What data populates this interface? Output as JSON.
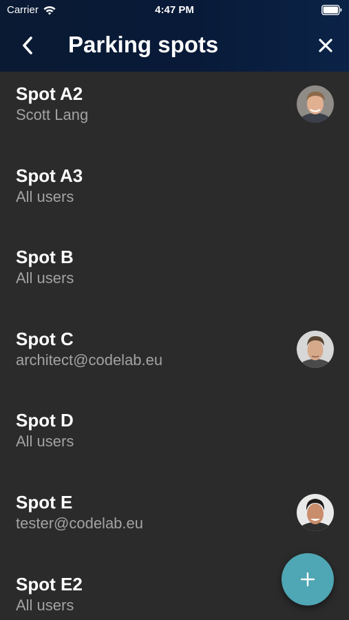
{
  "status_bar": {
    "carrier": "Carrier",
    "time": "4:47 PM"
  },
  "navbar": {
    "title": "Parking spots",
    "back_icon": "chevron-left-icon",
    "close_icon": "close-icon"
  },
  "spots": [
    {
      "name": "Spot A2",
      "user": "Scott Lang",
      "has_avatar": true
    },
    {
      "name": "Spot A3",
      "user": "All users",
      "has_avatar": false
    },
    {
      "name": "Spot B",
      "user": "All users",
      "has_avatar": false
    },
    {
      "name": "Spot C",
      "user": "architect@codelab.eu",
      "has_avatar": true
    },
    {
      "name": "Spot D",
      "user": "All users",
      "has_avatar": false
    },
    {
      "name": "Spot E",
      "user": "tester@codelab.eu",
      "has_avatar": true
    },
    {
      "name": "Spot E2",
      "user": "All users",
      "has_avatar": false
    }
  ],
  "fab": {
    "icon": "plus-icon"
  },
  "colors": {
    "header_bg": "#081a38",
    "list_bg": "#2b2b2b",
    "accent": "#4fa6b4"
  }
}
